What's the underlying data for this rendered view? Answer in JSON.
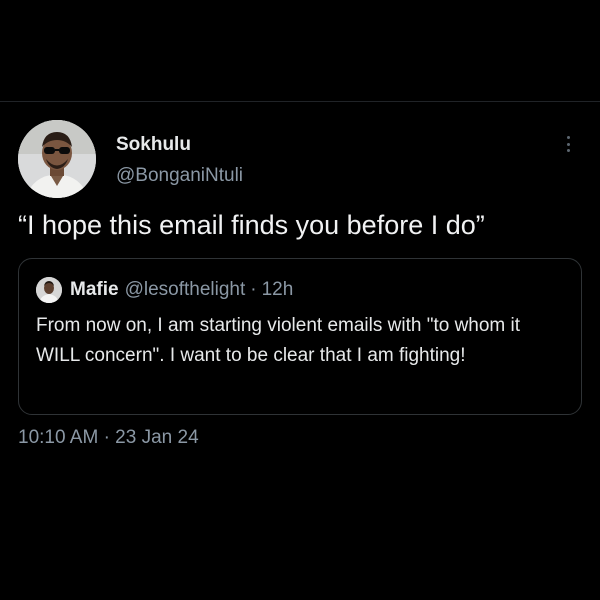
{
  "tweet": {
    "display_name": "Sokhulu",
    "handle": "@BonganiNtuli",
    "text": "“I hope this email finds you before I do”",
    "time": "10:10 AM",
    "separator": "·",
    "date": "23 Jan 24"
  },
  "quote": {
    "display_name": "Mafie",
    "handle": "@lesofthelight",
    "separator": "·",
    "time": "12h",
    "text": "From now on, I am starting violent emails with \"to whom it WILL concern\". I want to be clear that I am fighting!"
  },
  "icons": {
    "more": "more-options-icon"
  },
  "colors": {
    "background": "#000000",
    "primary_text": "#e7e9ea",
    "secondary_text": "#8b98a5",
    "border": "#2f3336"
  }
}
